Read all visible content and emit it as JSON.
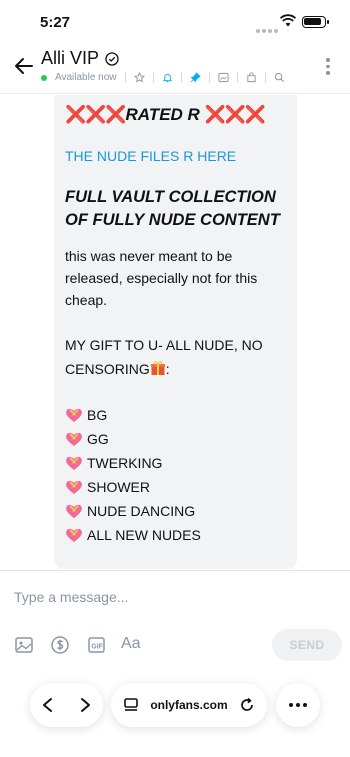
{
  "status_bar": {
    "time": "5:27"
  },
  "header": {
    "title": "Alli VIP",
    "availability": "Available now"
  },
  "message": {
    "heading_x": "❌❌❌",
    "heading_text": "RATED R ",
    "heading_x_end": "❌❌❌",
    "link_text": "THE NUDE FILES R HERE",
    "bold_line1": "FULL VAULT COLLECTION",
    "bold_line2": "OF FULLY NUDE CONTENT",
    "paragraph": "this was never meant to be released, especially not for this cheap.",
    "gift_line": "MY GIFT TO U- ALL NUDE, NO CENSORING",
    "gift_suffix": ":",
    "items": [
      "BG",
      "GG",
      "TWERKING",
      "SHOWER",
      "NUDE DANCING",
      "ALL NEW NUDES"
    ]
  },
  "composer": {
    "placeholder": "Type a message...",
    "send_label": "SEND",
    "format_label": "Aa"
  },
  "browser": {
    "url": "onlyfans.com"
  },
  "colors": {
    "accent": "#00aff0",
    "online": "#2dc653",
    "link": "#1d97d9",
    "x_red": "#e0202b"
  }
}
